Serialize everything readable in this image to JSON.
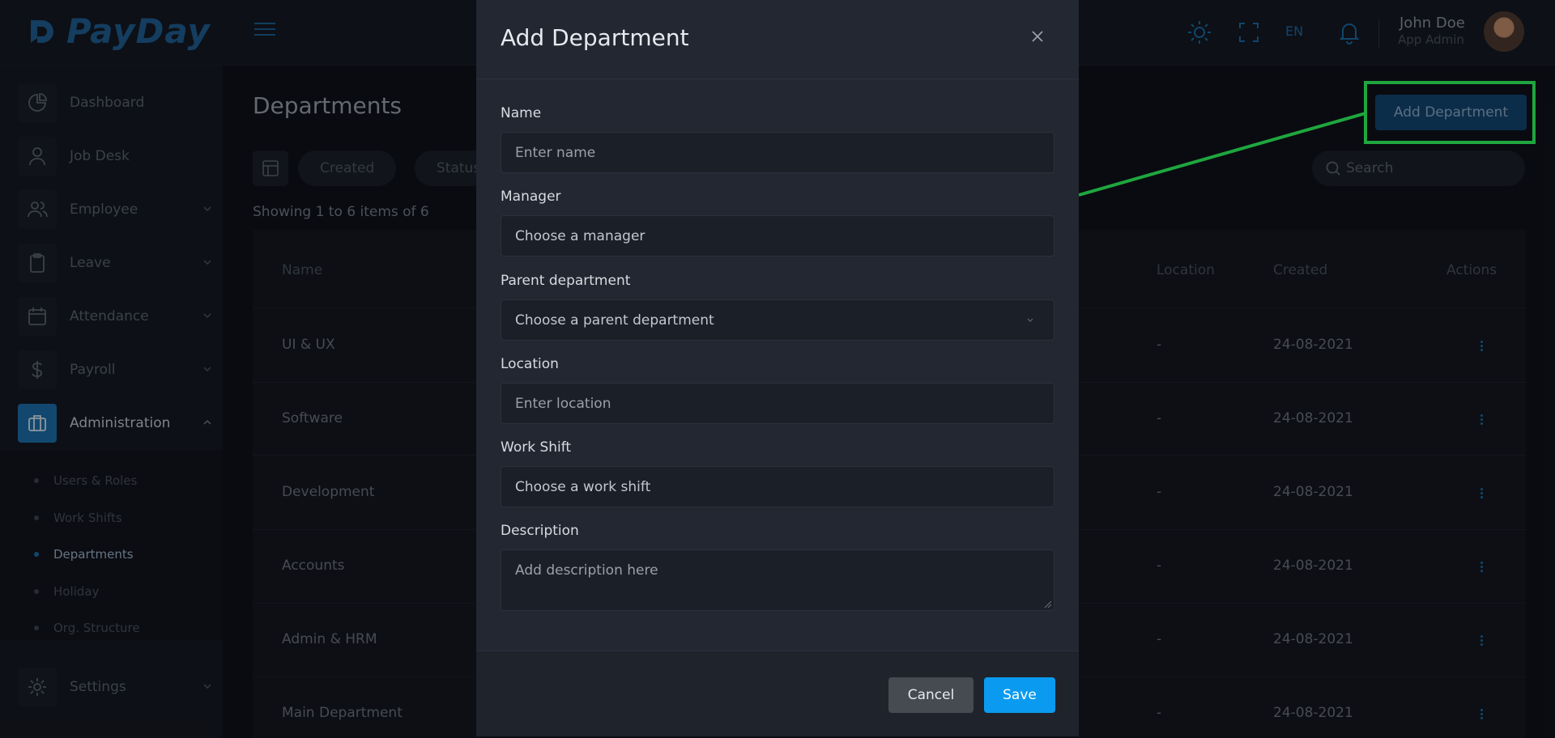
{
  "app": {
    "logo_text": "PayDay"
  },
  "header": {
    "language": "EN",
    "user_name": "John Doe",
    "user_role": "App Admin"
  },
  "sidebar": {
    "items": [
      {
        "label": "Dashboard",
        "icon": "pie-chart-icon"
      },
      {
        "label": "Job Desk",
        "icon": "user-icon"
      },
      {
        "label": "Employee",
        "icon": "users-icon"
      },
      {
        "label": "Leave",
        "icon": "clipboard-icon"
      },
      {
        "label": "Attendance",
        "icon": "calendar-icon"
      },
      {
        "label": "Payroll",
        "icon": "dollar-icon"
      },
      {
        "label": "Administration",
        "icon": "briefcase-icon"
      },
      {
        "label": "Settings",
        "icon": "gear-icon"
      }
    ],
    "sub_items": [
      "Users & Roles",
      "Work Shifts",
      "Departments",
      "Holiday",
      "Org. Structure"
    ]
  },
  "main": {
    "title": "Departments",
    "add_button": "Add Department",
    "filters": [
      "Created",
      "Status"
    ],
    "search_placeholder": "Search",
    "showing_text": "Showing 1 to 6 items of 6",
    "columns": {
      "name": "Name",
      "location": "Location",
      "created": "Created",
      "actions": "Actions"
    },
    "rows": [
      {
        "name": "UI & UX",
        "location": "-",
        "created": "24-08-2021"
      },
      {
        "name": "Software",
        "location": "-",
        "created": "24-08-2021"
      },
      {
        "name": "Development",
        "location": "-",
        "created": "24-08-2021"
      },
      {
        "name": "Accounts",
        "location": "-",
        "created": "24-08-2021"
      },
      {
        "name": "Admin & HRM",
        "location": "-",
        "created": "24-08-2021"
      },
      {
        "name": "Main Department",
        "location": "-",
        "created": "24-08-2021"
      }
    ]
  },
  "modal": {
    "title": "Add Department",
    "fields": {
      "name": {
        "label": "Name",
        "placeholder": "Enter name"
      },
      "manager": {
        "label": "Manager",
        "value": "Choose a manager"
      },
      "parent": {
        "label": "Parent department",
        "value": "Choose a parent department"
      },
      "location": {
        "label": "Location",
        "placeholder": "Enter location"
      },
      "work_shift": {
        "label": "Work Shift",
        "value": "Choose a work shift"
      },
      "description": {
        "label": "Description",
        "placeholder": "Add description here"
      }
    },
    "cancel": "Cancel",
    "save": "Save"
  },
  "colors": {
    "accent": "#0a9bf0",
    "highlight": "#1fa63e",
    "brand": "#1f5f92"
  }
}
